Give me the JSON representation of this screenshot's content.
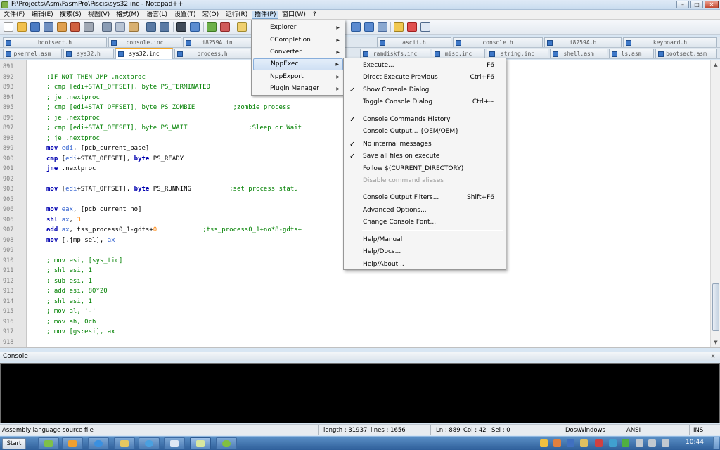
{
  "window": {
    "title": "F:\\Projects\\Asm\\FasmPro\\Piscis\\sys32.inc - Notepad++"
  },
  "menubar": [
    {
      "label": "文件(F)"
    },
    {
      "label": "编辑(E)"
    },
    {
      "label": "搜索(S)"
    },
    {
      "label": "视图(V)"
    },
    {
      "label": "格式(M)"
    },
    {
      "label": "语言(L)"
    },
    {
      "label": "设置(T)"
    },
    {
      "label": "宏(O)"
    },
    {
      "label": "运行(R)"
    },
    {
      "label": "插件(P)"
    },
    {
      "label": "窗口(W)"
    },
    {
      "label": "?"
    }
  ],
  "tabs_row1": [
    {
      "label": "bootsect.h"
    },
    {
      "label": "console.inc"
    },
    {
      "label": "i8259A.in"
    },
    {
      "label": "ascii.h"
    },
    {
      "label": "console.h"
    },
    {
      "label": "i8259A.h"
    },
    {
      "label": "keyboard.h"
    }
  ],
  "tabs_row2": [
    {
      "label": "pkernel.asm"
    },
    {
      "label": "sys32.h"
    },
    {
      "label": "sys32.inc"
    },
    {
      "label": "process.h"
    },
    {
      "label": "ramdiskfs.inc"
    },
    {
      "label": "misc.inc"
    },
    {
      "label": "string.inc"
    },
    {
      "label": "shell.asm"
    },
    {
      "label": "ls.asm"
    },
    {
      "label": "bootsect.asm"
    }
  ],
  "editor": {
    "lines": [
      {
        "n": "891",
        "code": ""
      },
      {
        "n": "892",
        "code": ";IF NOT THEN JMP .nextproc"
      },
      {
        "n": "893",
        "code": "; cmp [edi+STAT_OFFSET], byte PS_TERMINATED"
      },
      {
        "n": "894",
        "code": "; je .nextproc"
      },
      {
        "n": "895",
        "code": "; cmp [edi+STAT_OFFSET], byte PS_ZOMBIE          ;zombie process"
      },
      {
        "n": "896",
        "code": "; je .nextproc"
      },
      {
        "n": "897",
        "code": "; cmp [edi+STAT_OFFSET], byte PS_WAIT                ;Sleep or Wait"
      },
      {
        "n": "898",
        "code": "; je .nextproc"
      },
      {
        "n": "899",
        "code": "mov edi, [pcb_current_base]"
      },
      {
        "n": "900",
        "code": "cmp [edi+STAT_OFFSET], byte PS_READY"
      },
      {
        "n": "901",
        "code": "jne .nextproc"
      },
      {
        "n": "902",
        "code": ""
      },
      {
        "n": "903",
        "code": "mov [edi+STAT_OFFSET], byte PS_RUNNING          ;set process statu"
      },
      {
        "n": "905",
        "code": ""
      },
      {
        "n": "906",
        "code": "mov eax, [pcb_current_no]"
      },
      {
        "n": "906",
        "code": "shl ax, 3"
      },
      {
        "n": "907",
        "code": "add ax, tss_process0_1-gdts+0            ;tss_process0_1+no*8-gdts+"
      },
      {
        "n": "908",
        "code": "mov [.jmp_sel], ax"
      },
      {
        "n": "909",
        "code": ""
      },
      {
        "n": "910",
        "code": "; mov esi, [sys_tic]"
      },
      {
        "n": "911",
        "code": "; shl esi, 1"
      },
      {
        "n": "912",
        "code": "; sub esi, 1"
      },
      {
        "n": "913",
        "code": "; add esi, 80*20"
      },
      {
        "n": "914",
        "code": "; shl esi, 1"
      },
      {
        "n": "915",
        "code": "; mov al, '-'"
      },
      {
        "n": "916",
        "code": "; mov ah, 0ch"
      },
      {
        "n": "917",
        "code": "; mov [gs:esi], ax"
      },
      {
        "n": "918",
        "code": ""
      }
    ]
  },
  "plugins_menu": [
    {
      "label": "Explorer"
    },
    {
      "label": "CCompletion"
    },
    {
      "label": "Converter"
    },
    {
      "label": "NppExec"
    },
    {
      "label": "NppExport"
    },
    {
      "label": "Plugin Manager"
    }
  ],
  "nppexec_menu": [
    {
      "label": "Execute...",
      "shortcut": "F6",
      "checked": false,
      "disabled": false
    },
    {
      "label": "Direct Execute Previous",
      "shortcut": "Ctrl+F6",
      "checked": false,
      "disabled": false
    },
    {
      "label": "Show Console Dialog",
      "shortcut": "",
      "checked": true,
      "disabled": false
    },
    {
      "label": "Toggle Console Dialog",
      "shortcut": "Ctrl+~",
      "checked": false,
      "disabled": false
    },
    {
      "label": "Console Commands History",
      "shortcut": "",
      "checked": true,
      "disabled": false
    },
    {
      "label": "Console Output... {OEM/OEM}",
      "shortcut": "",
      "checked": false,
      "disabled": false
    },
    {
      "label": "No internal messages",
      "shortcut": "",
      "checked": true,
      "disabled": false
    },
    {
      "label": "Save all files on execute",
      "shortcut": "",
      "checked": true,
      "disabled": false
    },
    {
      "label": "Follow $(CURRENT_DIRECTORY)",
      "shortcut": "",
      "checked": false,
      "disabled": false
    },
    {
      "label": "Disable command aliases",
      "shortcut": "",
      "checked": false,
      "disabled": true
    },
    {
      "label": "Console Output Filters...",
      "shortcut": "Shift+F6",
      "checked": false,
      "disabled": false
    },
    {
      "label": "Advanced Options...",
      "shortcut": "",
      "checked": false,
      "disabled": false
    },
    {
      "label": "Change Console Font...",
      "shortcut": "",
      "checked": false,
      "disabled": false
    },
    {
      "label": "Help/Manual",
      "shortcut": "",
      "checked": false,
      "disabled": false
    },
    {
      "label": "Help/Docs...",
      "shortcut": "",
      "checked": false,
      "disabled": false
    },
    {
      "label": "Help/About...",
      "shortcut": "",
      "checked": false,
      "disabled": false
    }
  ],
  "console": {
    "title": "Console",
    "close": "x"
  },
  "statusbar": {
    "type": "Assembly language source file",
    "length": "length : 31937",
    "lines": "lines : 1656",
    "ln": "Ln : 889",
    "col": "Col : 42",
    "sel": "Sel : 0",
    "eol": "Dos\\Windows",
    "encoding": "ANSI",
    "mode": "INS"
  },
  "taskbar": {
    "start": "Start",
    "clock": "10:44"
  },
  "colors": {
    "comment": "#008000",
    "keyword": "#0000b0",
    "register": "#3060d0",
    "number": "#ff8000"
  }
}
